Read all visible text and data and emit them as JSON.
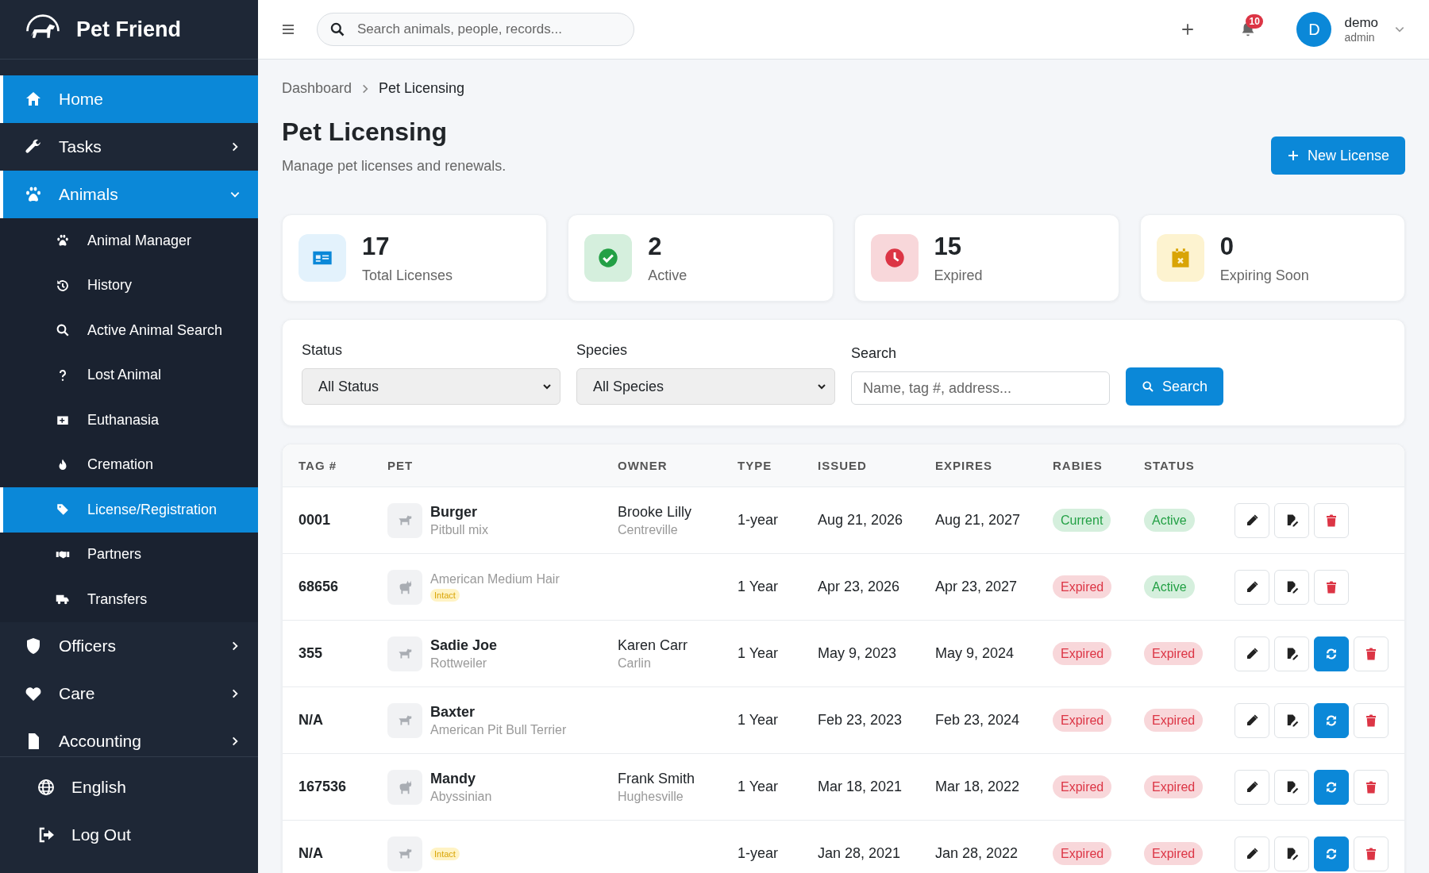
{
  "sidebar": {
    "brand": "Pet Friend",
    "items": [
      {
        "label": "Home",
        "selected": true
      },
      {
        "label": "Tasks",
        "selected": false,
        "expanded": false
      },
      {
        "label": "Animals",
        "selected": true,
        "expanded": true,
        "children": [
          {
            "label": "Animal Manager",
            "selected": false
          },
          {
            "label": "History",
            "selected": false
          },
          {
            "label": "Active Animal Search",
            "selected": false
          },
          {
            "label": "Lost Animal",
            "selected": false
          },
          {
            "label": "Euthanasia",
            "selected": false
          },
          {
            "label": "Cremation",
            "selected": false
          },
          {
            "label": "License/Registration",
            "selected": true
          },
          {
            "label": "Partners",
            "selected": false
          },
          {
            "label": "Transfers",
            "selected": false
          }
        ]
      },
      {
        "label": "Officers",
        "selected": false,
        "expanded": false
      },
      {
        "label": "Care",
        "selected": false,
        "expanded": false
      },
      {
        "label": "Accounting",
        "selected": false,
        "expanded": false
      }
    ],
    "footer": [
      "English",
      "Log Out"
    ]
  },
  "topbar": {
    "search": {
      "placeholder": "Search animals, people, records..."
    },
    "notifications": "10",
    "user": {
      "initial": "D",
      "name": "demo",
      "role": "admin"
    }
  },
  "breadcrumb": [
    "Dashboard",
    "Pet Licensing"
  ],
  "page": {
    "title": "Pet Licensing",
    "subtitle": "Manage pet licenses and renewals.",
    "action": "New License"
  },
  "stats": [
    {
      "kind": "total",
      "value": "17",
      "label": "Total Licenses"
    },
    {
      "kind": "active",
      "value": "2",
      "label": "Active"
    },
    {
      "kind": "expired",
      "value": "15",
      "label": "Expired"
    },
    {
      "kind": "expiring",
      "value": "0",
      "label": "Expiring Soon"
    }
  ],
  "filters": {
    "status": {
      "label": "Status",
      "value": "All Status"
    },
    "species": {
      "label": "Species",
      "value": "All Species"
    },
    "search": {
      "label": "Search",
      "placeholder": "Name, tag #, address..."
    },
    "button": "Search"
  },
  "table": {
    "columns": [
      "TAG #",
      "PET",
      "OWNER",
      "TYPE",
      "ISSUED",
      "EXPIRES",
      "RABIES",
      "STATUS"
    ],
    "rows": [
      {
        "tag": "0001",
        "pet": {
          "kind": "dog",
          "name": "Burger",
          "breed": "Pitbull mix"
        },
        "owner": "Brooke Lilly",
        "city": "Centreville",
        "type": "1-year",
        "issued": "Aug 21, 2026",
        "expires": "Aug 21, 2027",
        "rabies": {
          "kind": "ok",
          "text": "Current"
        },
        "status": {
          "kind": "ok",
          "text": "Active"
        },
        "renewable": false
      },
      {
        "tag": "68656",
        "pet": {
          "kind": "cat",
          "breed": "American Medium Hair",
          "badge": "Intact"
        },
        "type": "1 Year",
        "issued": "Apr 23, 2026",
        "expires": "Apr 23, 2027",
        "rabies": {
          "kind": "bad",
          "text": "Expired"
        },
        "status": {
          "kind": "ok",
          "text": "Active"
        },
        "renewable": false
      },
      {
        "tag": "355",
        "pet": {
          "kind": "dog",
          "name": "Sadie Joe",
          "breed": "Rottweiler"
        },
        "owner": "Karen Carr",
        "city": "Carlin",
        "type": "1 Year",
        "issued": "May 9, 2023",
        "expires": "May 9, 2024",
        "rabies": {
          "kind": "bad",
          "text": "Expired"
        },
        "status": {
          "kind": "bad",
          "text": "Expired"
        },
        "renewable": true
      },
      {
        "tag": "N/A",
        "pet": {
          "kind": "dog",
          "name": "Baxter",
          "breed": "American Pit Bull Terrier"
        },
        "type": "1 Year",
        "issued": "Feb 23, 2023",
        "expires": "Feb 23, 2024",
        "rabies": {
          "kind": "bad",
          "text": "Expired"
        },
        "status": {
          "kind": "bad",
          "text": "Expired"
        },
        "renewable": true
      },
      {
        "tag": "167536",
        "pet": {
          "kind": "cat",
          "name": "Mandy",
          "breed": "Abyssinian"
        },
        "owner": "Frank Smith",
        "city": "Hughesville",
        "type": "1 Year",
        "issued": "Mar 18, 2021",
        "expires": "Mar 18, 2022",
        "rabies": {
          "kind": "bad",
          "text": "Expired"
        },
        "status": {
          "kind": "bad",
          "text": "Expired"
        },
        "renewable": true
      },
      {
        "tag": "N/A",
        "pet": {
          "kind": "dog",
          "badge": "Intact"
        },
        "type": "1-year",
        "issued": "Jan 28, 2021",
        "expires": "Jan 28, 2022",
        "rabies": {
          "kind": "bad",
          "text": "Expired"
        },
        "status": {
          "kind": "bad",
          "text": "Expired"
        },
        "renewable": true
      }
    ]
  }
}
